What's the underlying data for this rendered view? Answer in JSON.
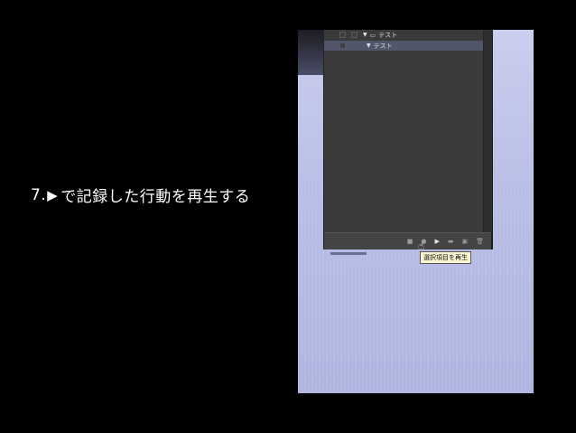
{
  "slide": {
    "caption_number": "7.",
    "caption_play_glyph": "▶",
    "caption_text": "で記録した行動を再生する"
  },
  "actions_panel": {
    "rows": [
      {
        "label": "テスト",
        "type": "set",
        "expanded": true,
        "selected": false
      },
      {
        "label": "テスト",
        "type": "action",
        "expanded": true,
        "selected": true
      }
    ],
    "toolbar": {
      "icons": [
        "stop-icon",
        "record-icon",
        "play-icon",
        "new-set-icon",
        "new-action-icon",
        "delete-icon"
      ],
      "glyphs": {
        "stop": "■",
        "record": "●",
        "play": "▶",
        "new_set": "▬",
        "new_action": "▣",
        "delete": "🗑"
      }
    },
    "tooltip": "選択項目を再生",
    "cursor_glyph": "☝"
  },
  "colors": {
    "background": "#000000",
    "panel": "#3a3a3a",
    "selected_row": "#52566a",
    "tooltip_bg": "#fbf6d0",
    "desktop": "#b9bfe6"
  }
}
